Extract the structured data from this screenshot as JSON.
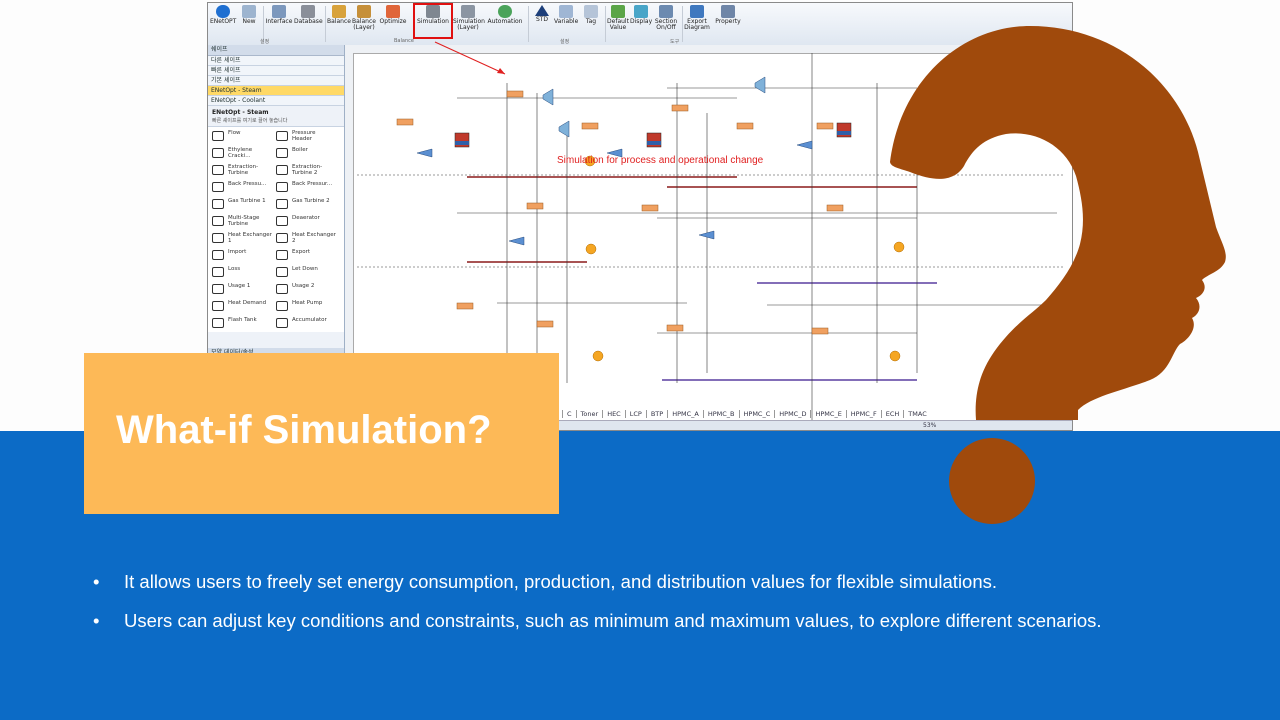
{
  "slide": {
    "title": "What-if Simulation?",
    "bullet_char": "•",
    "bullets": [
      "It allows users to freely set energy consumption, production, and distribution values for flexible simulations.",
      "Users can adjust key conditions and constraints, such as minimum and maximum values, to explore different scenarios."
    ],
    "colors": {
      "band": "#0c6bc6",
      "title_card": "#fdb957",
      "head": "#a04a0c",
      "annotation": "#e02020"
    }
  },
  "app": {
    "ribbon": {
      "buttons": [
        "ENetOPT",
        "New",
        "Interface",
        "Database",
        "Balance",
        "Balance (Layer)",
        "Optimize",
        "Simulation",
        "Simulation (Layer)",
        "Automation",
        "STD",
        "Variable",
        "Tag",
        "Default Value",
        "Display",
        "Section On/Off",
        "Export Diagram",
        "Property"
      ],
      "active": "Simulation",
      "groups": [
        "설정",
        "Balance",
        "설정",
        "도구"
      ]
    },
    "left_pane": {
      "header": "쉐이프",
      "rows": [
        "다른 셰이프",
        "빠른 셰이프",
        "기본 셰이프",
        "ENetOpt - Steam",
        "ENetOpt - Coolant"
      ],
      "selected_row": "ENetOpt - Steam",
      "section_title": "ENetOpt - Steam",
      "section_subtitle": "빠른 셰이프를 여기로 끌어 놓습니다",
      "shapes": [
        "Flow",
        "Pressure Header",
        "Ethylene Cracki...",
        "Boiler",
        "Extraction-Turbine",
        "Extraction-Turbine 2",
        "Back Pressu...",
        "Back Pressur...",
        "Gas Turbine 1",
        "Gas Turbine 2",
        "Multi-Stage Turbine",
        "Deaerator",
        "Heat Exchanger 1",
        "Heat Exchanger 2",
        "Import",
        "Export",
        "Loss",
        "Let Down",
        "Usage 1",
        "Usage 2",
        "Heat Demand",
        "Heat Pump",
        "Flash Tank",
        "Accumulator"
      ],
      "footer": "모양 데이터/속성"
    },
    "annotation": "Simulation for process and operational change",
    "page_tabs": [
      "C",
      "Toner",
      "HEC",
      "LCP",
      "BTP",
      "HPMC_A",
      "HPMC_B",
      "HPMC_C",
      "HPMC_D",
      "HPMC_E",
      "HPMC_F",
      "ECH",
      "TMAC"
    ],
    "zoom": "53%"
  }
}
